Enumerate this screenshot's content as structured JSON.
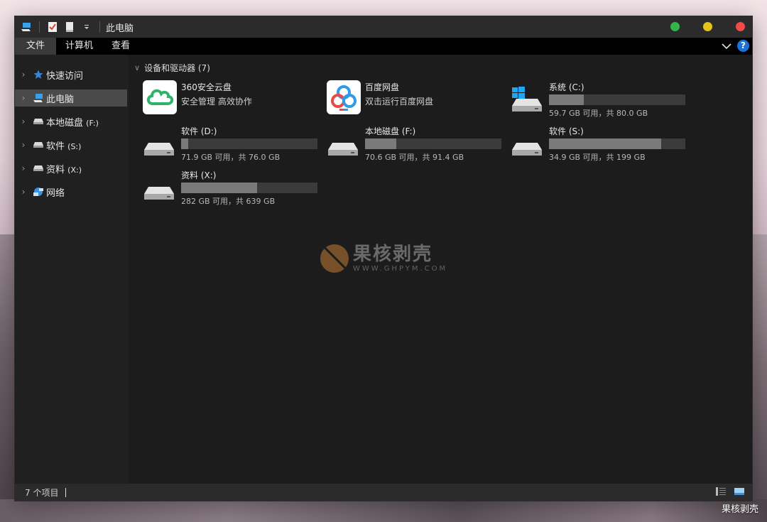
{
  "window": {
    "title": "此电脑",
    "colors": {
      "close": "#f04a4a",
      "minimize": "#e6c21b",
      "maximize": "#32b649"
    }
  },
  "ribbon": {
    "tabs": [
      "文件",
      "计算机",
      "查看"
    ],
    "help_label": "?"
  },
  "sidebar": {
    "items": [
      {
        "label": "快速访问",
        "icon": "star-icon"
      },
      {
        "label": "此电脑",
        "icon": "computer-icon",
        "selected": true
      },
      {
        "label": "本地磁盘",
        "suffix": "(F:)",
        "icon": "drive-icon"
      },
      {
        "label": "软件",
        "suffix": "(S:)",
        "icon": "drive-icon"
      },
      {
        "label": "资料",
        "suffix": "(X:)",
        "icon": "drive-icon"
      },
      {
        "label": "网络",
        "icon": "network-icon"
      }
    ]
  },
  "content": {
    "group_title": "设备和驱动器 (7)",
    "apps": [
      {
        "name": "360安全云盘",
        "subtitle": "安全管理 高效协作",
        "icon": "360-cloud-icon"
      },
      {
        "name": "百度网盘",
        "subtitle": "双击运行百度网盘",
        "icon": "baidu-netdisk-icon"
      }
    ],
    "drives": [
      {
        "name": "系统 (C:)",
        "free_text": "59.7 GB 可用，共 80.0 GB",
        "used_fraction": 0.254,
        "icon": "windows-drive-icon"
      },
      {
        "name": "软件 (D:)",
        "free_text": "71.9 GB 可用，共 76.0 GB",
        "used_fraction": 0.054,
        "icon": "drive-icon"
      },
      {
        "name": "本地磁盘 (F:)",
        "free_text": "70.6 GB 可用，共 91.4 GB",
        "used_fraction": 0.228,
        "icon": "drive-icon"
      },
      {
        "name": "软件 (S:)",
        "free_text": "34.9 GB 可用，共 199 GB",
        "used_fraction": 0.825,
        "icon": "drive-icon"
      },
      {
        "name": "资料 (X:)",
        "free_text": "282 GB 可用，共 639 GB",
        "used_fraction": 0.559,
        "icon": "drive-icon"
      }
    ]
  },
  "watermark": {
    "title": "果核剥壳",
    "url": "WWW.GHPYM.COM"
  },
  "status": {
    "count": "7 个项目"
  },
  "corner_watermark": "果核剥壳"
}
